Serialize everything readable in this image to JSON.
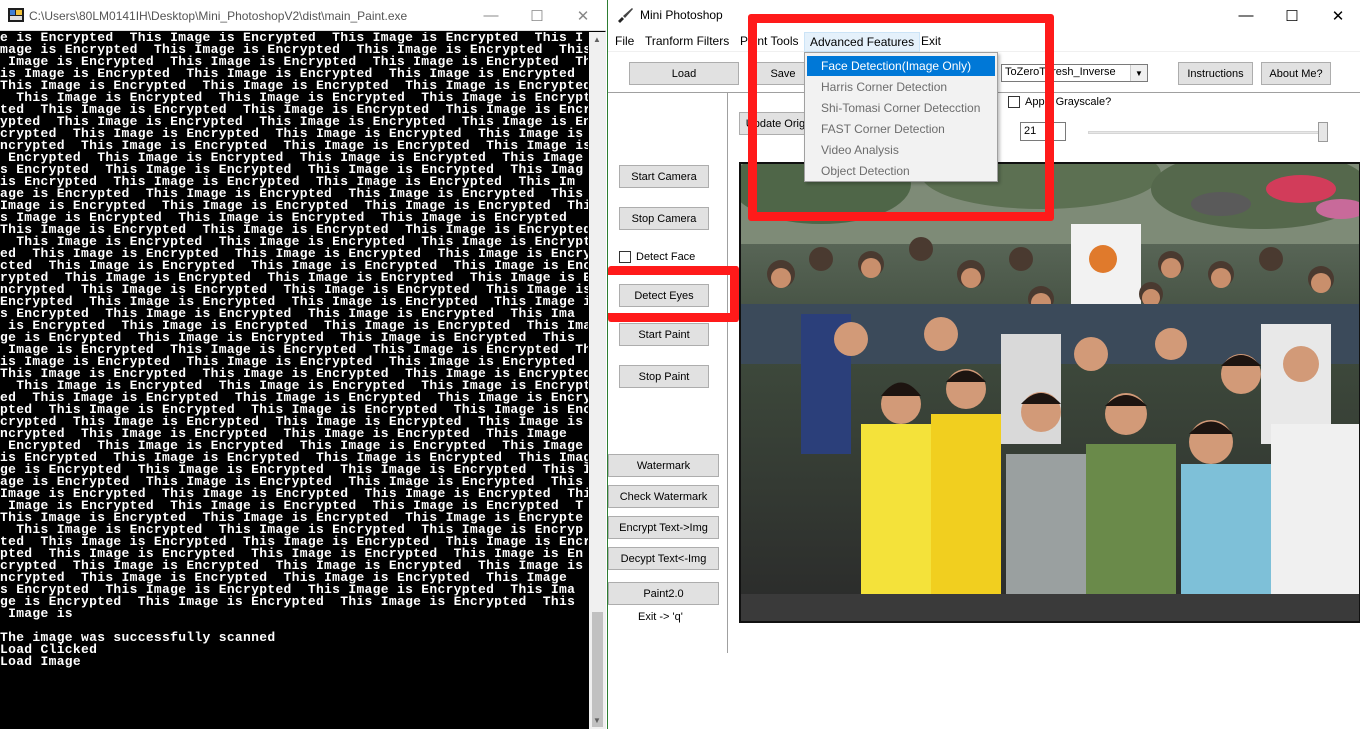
{
  "console": {
    "title": "C:\\Users\\80LM0141IH\\Desktop\\Mini_PhotoshopV2\\dist\\main_Paint.exe",
    "controls": {
      "minimize": "—",
      "maximize": "☐",
      "close": "✕"
    },
    "lines": [
      "e is Encrypted  This Image is Encrypted  This Image is Encrypted  This I",
      "mage is Encrypted  This Image is Encrypted  This Image is Encrypted  This",
      " Image is Encrypted  This Image is Encrypted  This Image is Encrypted  Th",
      "is Image is Encrypted  This Image is Encrypted  This Image is Encrypted",
      "This Image is Encrypted  This Image is Encrypted  This Image is Encrypted",
      "  This Image is Encrypted  This Image is Encrypted  This Image is Encrypt",
      "ted  This Image is Encrypted  This Image is Encrypted  This Image is Encry",
      "ypted  This Image is Encrypted  This Image is Encrypted  This Image is Enc",
      "crypted  This Image is Encrypted  This Image is Encrypted  This Image is E",
      "ncrypted  This Image is Encrypted  This Image is Encrypted  This Image is",
      " Encrypted  This Image is Encrypted  This Image is Encrypted  This Image",
      "s Encrypted  This Image is Encrypted  This Image is Encrypted  This Imag",
      "is Encrypted  This Image is Encrypted  This Image is Encrypted  This Im",
      "age is Encrypted  This Image is Encrypted  This Image is Encrypted  This",
      "Image is Encrypted  This Image is Encrypted  This Image is Encrypted  Thi",
      "s Image is Encrypted  This Image is Encrypted  This Image is Encrypted",
      "This Image is Encrypted  This Image is Encrypted  This Image is Encrypted",
      "  This Image is Encrypted  This Image is Encrypted  This Image is Encrypte",
      "ed  This Image is Encrypted  This Image is Encrypted  This Image is Encryp",
      "cted  This Image is Encrypted  This Image is Encrypted  This Image is Encr",
      "rypted  This Image is Encrypted  This Image is Encrypted  This Image is En",
      "ncrypted  This Image is Encrypted  This Image is Encrypted  This Image is",
      "Encrypted  This Image is Encrypted  This Image is Encrypted  This Image i",
      "s Encrypted  This Image is Encrypted  This Image is Encrypted  This Ima",
      " is Encrypted  This Image is Encrypted  This Image is Encrypted  This Ima",
      "ge is Encrypted  This Image is Encrypted  This Image is Encrypted  This",
      " Image is Encrypted  This Image is Encrypted  This Image is Encrypted  Th",
      "is Image is Encrypted  This Image is Encrypted  This Image is Encrypted",
      "This Image is Encrypted  This Image is Encrypted  This Image is Encrypted",
      "  This Image is Encrypted  This Image is Encrypted  This Image is Encrypt",
      "ed  This Image is Encrypted  This Image is Encrypted  This Image is Encry",
      "pted  This Image is Encrypted  This Image is Encrypted  This Image is Enc",
      "crypted  This Image is Encrypted  This Image is Encrypted  This Image is E",
      "ncrypted  This Image is Encrypted  This Image is Encrypted  This Image",
      " Encrypted  This Image is Encrypted  This Image is Encrypted  This Image",
      "is Encrypted  This Image is Encrypted  This Image is Encrypted  This Imag",
      "ge is Encrypted  This Image is Encrypted  This Image is Encrypted  This Im",
      "age is Encrypted  This Image is Encrypted  This Image is Encrypted  This",
      "Image is Encrypted  This Image is Encrypted  This Image is Encrypted  Thi",
      " Image is Encrypted  This Image is Encrypted  This Image is Encrypted  T",
      "This Image is Encrypted  This Image is Encrypted  This Image is Encrypte",
      "  This Image is Encrypted  This Image is Encrypted  This Image is Encryp",
      "ted  This Image is Encrypted  This Image is Encrypted  This Image is Encr",
      "pted  This Image is Encrypted  This Image is Encrypted  This Image is En",
      "crypted  This Image is Encrypted  This Image is Encrypted  This Image is",
      "ncrypted  This Image is Encrypted  This Image is Encrypted  This Image",
      "s Encrypted  This Image is Encrypted  This Image is Encrypted  This Ima",
      "ge is Encrypted  This Image is Encrypted  This Image is Encrypted  This",
      " Image is",
      "",
      "The image was successfully scanned",
      "Load Clicked",
      "Load Image"
    ]
  },
  "ps": {
    "title": "Mini Photoshop",
    "controls": {
      "minimize": "—",
      "maximize": "☐",
      "close": "✕"
    },
    "menu": {
      "file": "File",
      "transform": "Tranform Filters",
      "paint": "Paint Tools",
      "advanced": "Advanced Features",
      "exit": "Exit"
    },
    "toolbar": {
      "load": "Load",
      "save": "Save",
      "threshold_select": "ToZeroThresh_Inverse",
      "instructions": "Instructions",
      "about": "About Me?",
      "grayscale_label": "Apply Grayscale?",
      "update_original": "Update Original",
      "spin_value": "21"
    },
    "slider_fraction": 0.98,
    "side": {
      "start_camera": "Start Camera",
      "stop_camera": "Stop Camera",
      "detect_face": "Detect Face",
      "detect_eyes": "Detect Eyes",
      "start_paint": "Start Paint",
      "stop_paint": "Stop Paint",
      "watermark": "Watermark",
      "check_watermark": "Check Watermark",
      "encrypt": "Encrypt Text->Img",
      "decrypt": "Decypt Text<-Img",
      "paint2": "Paint2.0",
      "exit_hint": "Exit -> 'q'"
    },
    "dropdown": [
      {
        "label": "Face Detection(Image Only)",
        "selected": true
      },
      {
        "label": "Harris Corner Detection",
        "selected": false
      },
      {
        "label": "Shi-Tomasi Corner Detecction",
        "selected": false
      },
      {
        "label": "FAST Corner Detection",
        "selected": false
      },
      {
        "label": "Video Analysis",
        "selected": false
      },
      {
        "label": "Object Detection",
        "selected": false
      }
    ],
    "colors": {
      "highlight": "#0078d7",
      "annotation": "#ff1a1a",
      "photo_frame": "#111111"
    }
  }
}
